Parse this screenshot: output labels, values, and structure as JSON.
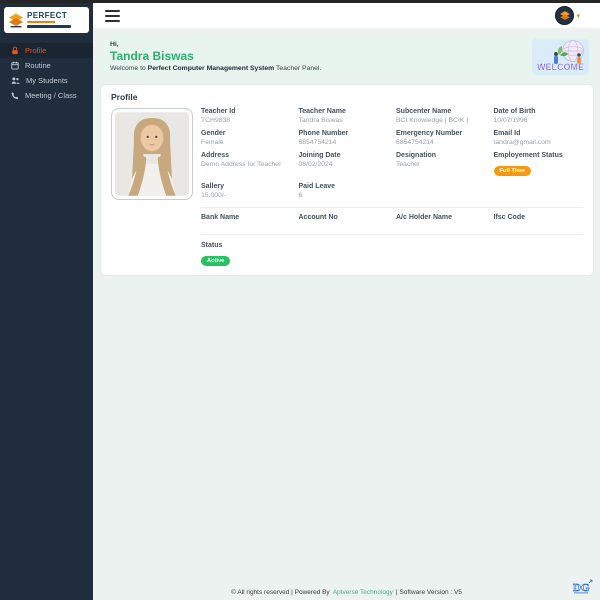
{
  "colors": {
    "sidebar_bg": "#1f2d3c",
    "accent_orange": "#e2571d",
    "brand_navy": "#1b3a5c",
    "name_green": "#2fae6e",
    "banner_bg": "#e8f5ee",
    "badge_orange": "#f59b0b",
    "badge_green": "#28c165",
    "vendor_green": "#45b08c"
  },
  "brand": {
    "name": "PERFECT"
  },
  "sidebar": {
    "items": [
      {
        "label": "Profile",
        "icon": "lock-icon",
        "active": true
      },
      {
        "label": "Routine",
        "icon": "calendar-icon",
        "active": false
      },
      {
        "label": "My Students",
        "icon": "users-icon",
        "active": false
      },
      {
        "label": "Meeting / Class",
        "icon": "phone-icon",
        "active": false
      }
    ]
  },
  "header": {
    "menu_icon": "hamburger-icon",
    "avatar_icon": "brand-diamond-icon",
    "caret": "▾"
  },
  "welcome": {
    "greeting": "Hi,",
    "name": "Tandra Biswas",
    "prefix": "Welcome to ",
    "system": "Perfect Computer Management System",
    "suffix": " Teacher Panel.",
    "illustration_word": "WELCOME"
  },
  "profile_card": {
    "title": "Profile",
    "fields": [
      {
        "label": "Teacher Id",
        "value": "TCH9838"
      },
      {
        "label": "Teacher Name",
        "value": "Tandra Biswas"
      },
      {
        "label": "Subcenter Name",
        "value": "BCI Knowledge [ BCIK ]"
      },
      {
        "label": "Date of Birth",
        "value": "10/07/1996"
      },
      {
        "label": "Gender",
        "value": "Female"
      },
      {
        "label": "Phone Number",
        "value": "6854754214"
      },
      {
        "label": "Emergency Number",
        "value": "6854754214"
      },
      {
        "label": "Email Id",
        "value": "tandra@gmail.com"
      },
      {
        "label": "Address",
        "value": "Demo Address for Teacher"
      },
      {
        "label": "Joining Date",
        "value": "08/02/2024"
      },
      {
        "label": "Designation",
        "value": "Teacher"
      },
      {
        "label": "Employement Status",
        "badge": "Full Time"
      },
      {
        "label": "Sallery",
        "value": "15,000/-"
      },
      {
        "label": "Paid Leave",
        "value": "6"
      }
    ],
    "bank_fields": [
      {
        "label": "Bank Name",
        "value": ""
      },
      {
        "label": "Account No",
        "value": ""
      },
      {
        "label": "A/c Holder Name",
        "value": ""
      },
      {
        "label": "Ifsc Code",
        "value": ""
      }
    ],
    "status_label": "Status",
    "status_badge": "Active"
  },
  "footer": {
    "part1": "© All rights reserved | Powered By",
    "vendor": "Aptverse Technology",
    "part2": "| Software Version : V5",
    "corner_logo": "DG"
  }
}
